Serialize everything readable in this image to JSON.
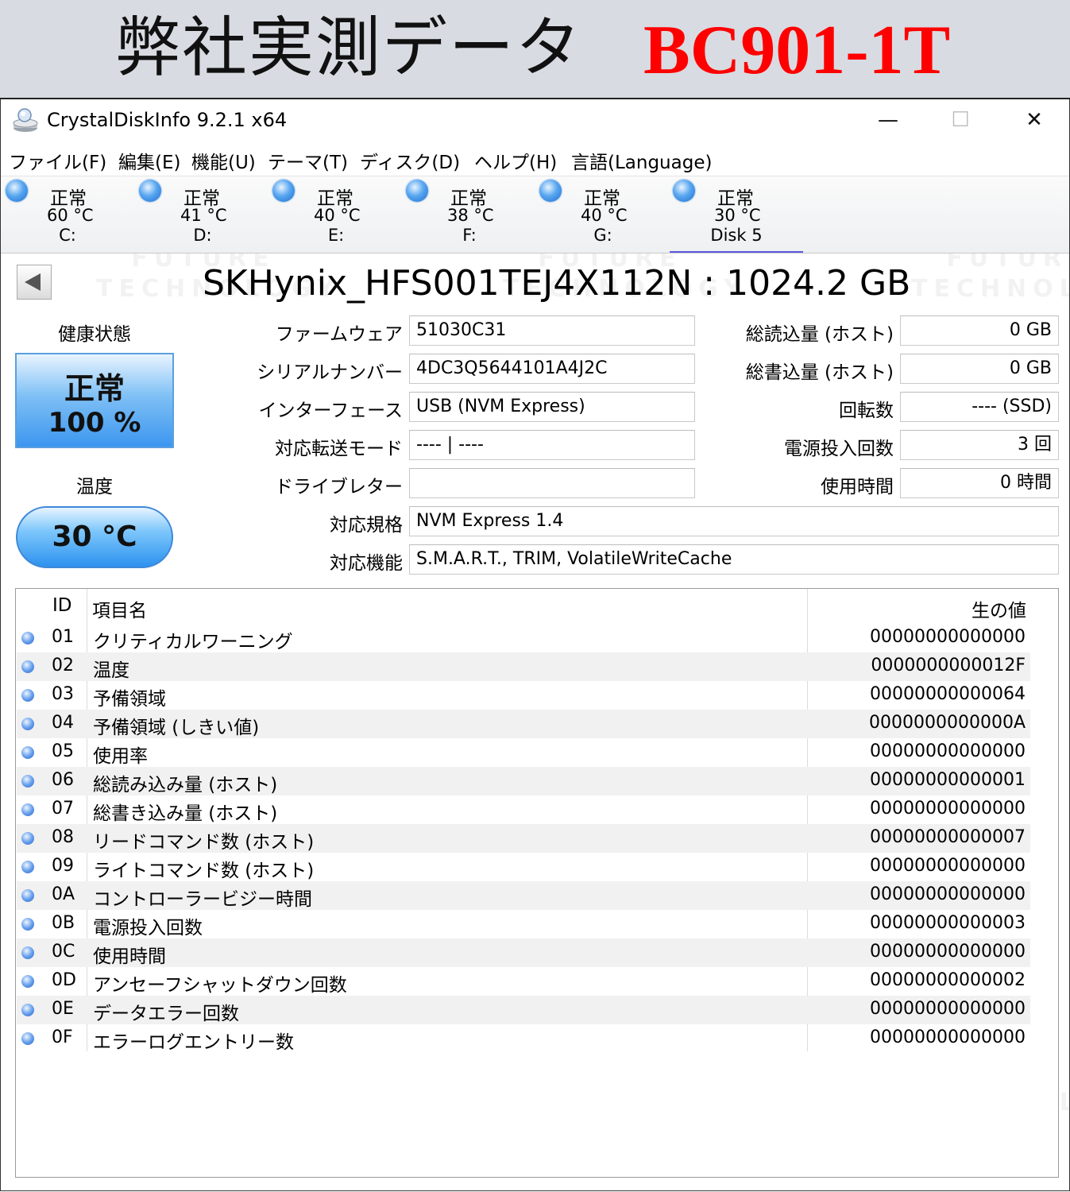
{
  "banner": {
    "title": "弊社実測データ",
    "model": "BC901-1T",
    "model_color": "#ff0000"
  },
  "window": {
    "title": "CrystalDiskInfo 9.2.1 x64",
    "app_icon": "crystaldiskinfo-icon",
    "controls": {
      "minimize": "—",
      "maximize": "☐",
      "close": "✕"
    }
  },
  "menu": [
    "ファイル(F)",
    "編集(E)",
    "機能(U)",
    "テーマ(T)",
    "ディスク(D)",
    "ヘルプ(H)",
    "言語(Language)"
  ],
  "drives": [
    {
      "status": "正常",
      "temp": "60 °C",
      "letter": "C:"
    },
    {
      "status": "正常",
      "temp": "41 °C",
      "letter": "D:"
    },
    {
      "status": "正常",
      "temp": "40 °C",
      "letter": "E:"
    },
    {
      "status": "正常",
      "temp": "38 °C",
      "letter": "F:"
    },
    {
      "status": "正常",
      "temp": "40 °C",
      "letter": "G:"
    },
    {
      "status": "正常",
      "temp": "30 °C",
      "letter": "Disk 5"
    }
  ],
  "disk": {
    "model_title": "SKHynix_HFS001TEJ4X112N : 1024.2 GB",
    "health_label": "健康状態",
    "health_status": "正常",
    "health_percent": "100 %",
    "temp_label": "温度",
    "temp_value": "30 °C",
    "health_color": "#3c96ef"
  },
  "fields_left": [
    {
      "label": "ファームウェア",
      "value": "51030C31"
    },
    {
      "label": "シリアルナンバー",
      "value": "4DC3Q5644101A4J2C"
    },
    {
      "label": "インターフェース",
      "value": "USB (NVM Express)"
    },
    {
      "label": "対応転送モード",
      "value": "---- | ----"
    },
    {
      "label": "ドライブレター",
      "value": ""
    }
  ],
  "fields_right": [
    {
      "label": "総読込量 (ホスト)",
      "value": "0 GB"
    },
    {
      "label": "総書込量 (ホスト)",
      "value": "0 GB"
    },
    {
      "label": "回転数",
      "value": "---- (SSD)"
    },
    {
      "label": "電源投入回数",
      "value": "3 回"
    },
    {
      "label": "使用時間",
      "value": "0 時間"
    }
  ],
  "fields_wide": [
    {
      "label": "対応規格",
      "value": "NVM Express 1.4"
    },
    {
      "label": "対応機能",
      "value": "S.M.A.R.T., TRIM, VolatileWriteCache"
    }
  ],
  "smart": {
    "headers": {
      "id": "ID",
      "name": "項目名",
      "raw": "生の値"
    },
    "rows": [
      {
        "id": "01",
        "name": "クリティカルワーニング",
        "raw": "00000000000000"
      },
      {
        "id": "02",
        "name": "温度",
        "raw": "0000000000012F"
      },
      {
        "id": "03",
        "name": "予備領域",
        "raw": "00000000000064"
      },
      {
        "id": "04",
        "name": "予備領域 (しきい値)",
        "raw": "0000000000000A"
      },
      {
        "id": "05",
        "name": "使用率",
        "raw": "00000000000000"
      },
      {
        "id": "06",
        "name": "総読み込み量 (ホスト)",
        "raw": "00000000000001"
      },
      {
        "id": "07",
        "name": "総書き込み量 (ホスト)",
        "raw": "00000000000000"
      },
      {
        "id": "08",
        "name": "リードコマンド数 (ホスト)",
        "raw": "00000000000007"
      },
      {
        "id": "09",
        "name": "ライトコマンド数 (ホスト)",
        "raw": "00000000000000"
      },
      {
        "id": "0A",
        "name": "コントローラービジー時間",
        "raw": "00000000000000"
      },
      {
        "id": "0B",
        "name": "電源投入回数",
        "raw": "00000000000003"
      },
      {
        "id": "0C",
        "name": "使用時間",
        "raw": "00000000000000"
      },
      {
        "id": "0D",
        "name": "アンセーフシャットダウン回数",
        "raw": "00000000000002"
      },
      {
        "id": "0E",
        "name": "データエラー回数",
        "raw": "00000000000000"
      },
      {
        "id": "0F",
        "name": "エラーログエントリー数",
        "raw": "00000000000000"
      }
    ]
  },
  "watermark": {
    "line1": "FUTURE",
    "line2": "TECHNOLOGY"
  }
}
